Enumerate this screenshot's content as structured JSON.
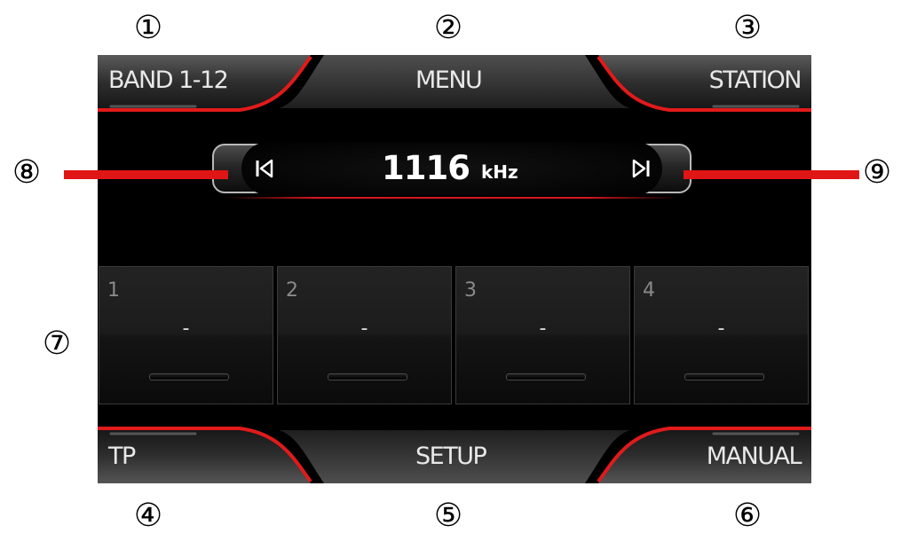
{
  "callouts": {
    "c1": "①",
    "c2": "②",
    "c3": "③",
    "c4": "④",
    "c5": "⑤",
    "c6": "⑥",
    "c7": "⑦",
    "c8": "⑧",
    "c9": "⑨"
  },
  "top_bar": {
    "band_label": "BAND 1-12",
    "menu_label": "MENU",
    "station_label": "STATION"
  },
  "frequency": {
    "value": "1116",
    "unit": "kHz",
    "prev_icon": "seek-back-icon",
    "next_icon": "seek-forward-icon"
  },
  "presets": [
    {
      "number": "1",
      "name": "-"
    },
    {
      "number": "2",
      "name": "-"
    },
    {
      "number": "3",
      "name": "-"
    },
    {
      "number": "4",
      "name": "-"
    }
  ],
  "bottom_bar": {
    "tp_label": "TP",
    "setup_label": "SETUP",
    "manual_label": "MANUAL"
  },
  "colors": {
    "accent_red": "#e01515",
    "screen_background": "#000000",
    "label_text": "#e8e8e8"
  }
}
